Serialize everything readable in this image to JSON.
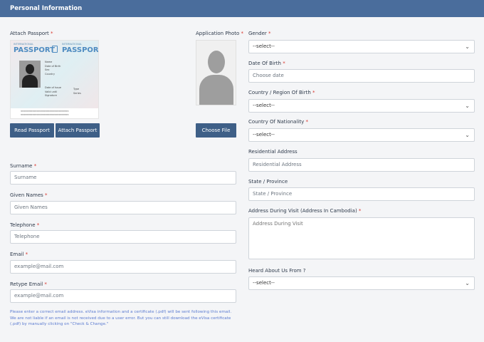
{
  "header": {
    "title": "Personal Information"
  },
  "attach_passport": {
    "label": "Attach Passport",
    "sample": {
      "heading_small": "INTERNATIONAL",
      "heading": "PASSPORT",
      "fields": [
        "Name",
        "Date of Birth",
        "Sex",
        "Country"
      ],
      "fields2": [
        "Date of Issue",
        "Valid until",
        "Signature"
      ],
      "fields3": [
        "Type",
        "Series"
      ],
      "mrz1": "<<<<<<<<<<<<<<<<<<<<<<<<<<<<<<<<<",
      "mrz2": "<<<<<<<<<<<<<<<<<<<<<<<<<<<<<<<<<"
    },
    "read_button": "Read Passport",
    "attach_button": "Attach Passport"
  },
  "application_photo": {
    "label": "Application Photo",
    "button": "Choose File"
  },
  "left_fields": {
    "surname": {
      "label": "Surname",
      "placeholder": "Surname"
    },
    "given_names": {
      "label": "Given Names",
      "placeholder": "Given Names"
    },
    "telephone": {
      "label": "Telephone",
      "placeholder": "Telephone"
    },
    "email": {
      "label": "Email",
      "placeholder": "example@mail.com"
    },
    "retype_email": {
      "label": "Retype Email",
      "placeholder": "example@mail.com"
    }
  },
  "note": "Please enter a correct email address. eVisa information and a certificate (.pdf) will be sent following this email. We are not liable if an email is not received due to a user error. But you can still download the eVisa certificate (.pdf) by manually clicking on \"Check & Change.\"",
  "right_fields": {
    "gender": {
      "label": "Gender",
      "value": "--select--"
    },
    "dob": {
      "label": "Date Of Birth",
      "placeholder": "Choose date"
    },
    "country_birth": {
      "label": "Country / Region Of Birth",
      "value": "--select--"
    },
    "nationality": {
      "label": "Country Of Nationality",
      "value": "--select--"
    },
    "residential": {
      "label": "Residential Address",
      "placeholder": "Residential Address"
    },
    "state": {
      "label": "State / Province",
      "placeholder": "State / Province"
    },
    "address_visit": {
      "label": "Address During Visit (Address In Cambodia)",
      "placeholder": "Address During Visit"
    },
    "heard": {
      "label": "Heard About Us From ?",
      "value": "--select--"
    }
  },
  "required_mark": "*",
  "colors": {
    "header": "#4a6d9c",
    "button": "#3e5f87",
    "required": "#d9342b",
    "note": "#5b7bd0"
  }
}
